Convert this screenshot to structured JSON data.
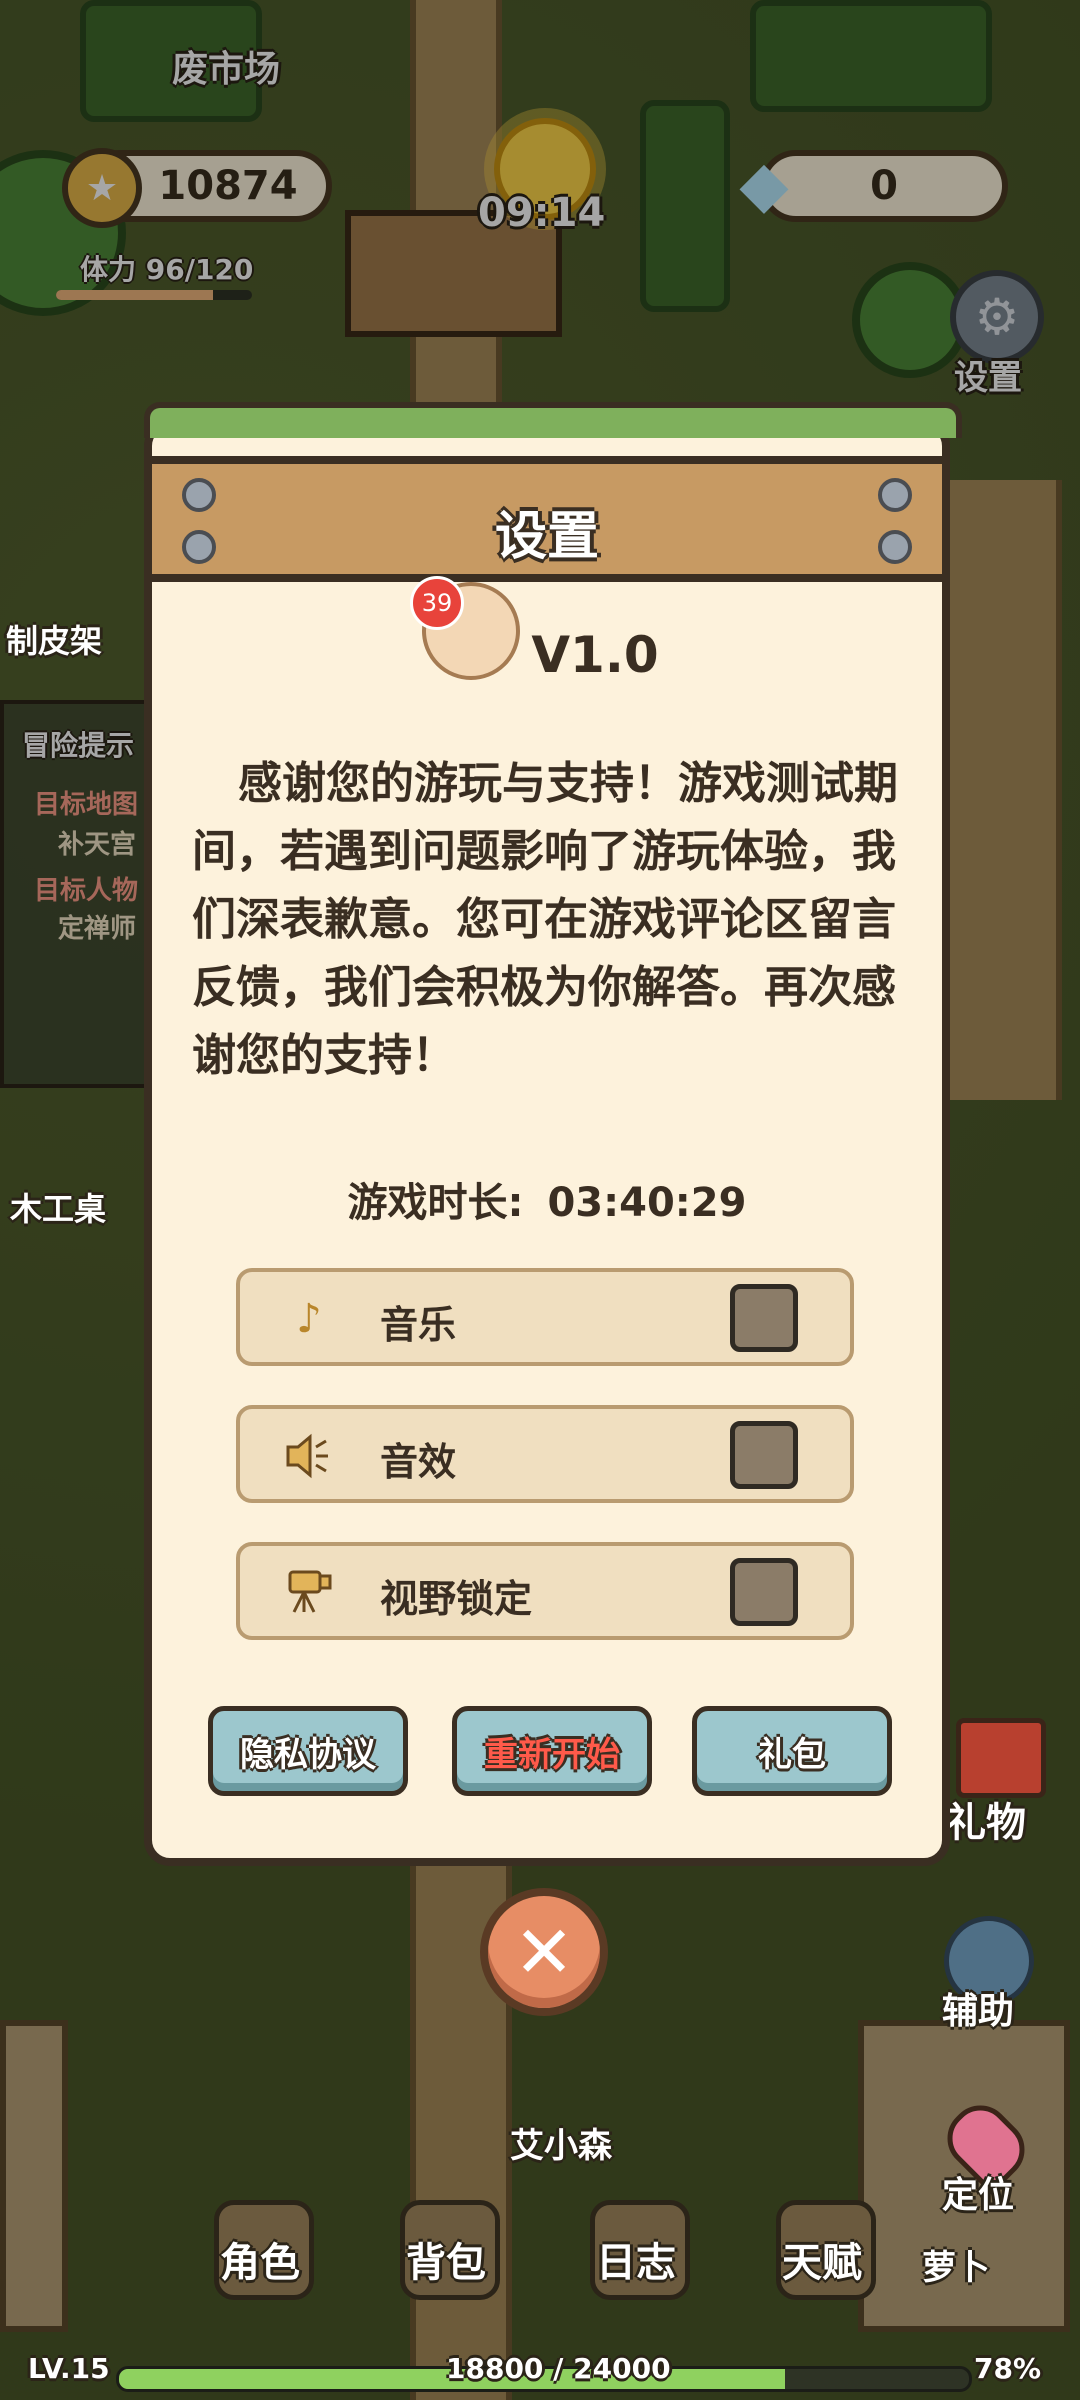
{
  "hud": {
    "coins": "10874",
    "time": "09:14",
    "gems": "0",
    "stamina": "体力 96/120",
    "stamina_progress": 0.8
  },
  "map_labels": {
    "waste_market": "废市场",
    "tannery": "制皮架",
    "workbench": "木工桌",
    "npc_name": "艾小森",
    "carrot": "萝卜"
  },
  "quest_panel": {
    "title": "冒险提示",
    "target_map_label": "目标地图",
    "target_map_value": "补天宫",
    "target_char_label": "目标人物",
    "target_char_value": "定禅师"
  },
  "side_buttons": {
    "settings": "设置",
    "gift": "礼物",
    "assist": "辅助",
    "locate": "定位"
  },
  "dialog": {
    "title": "设置",
    "version": "V1.0",
    "badge_count": "39",
    "thanks_text": "感谢您的游玩与支持！游戏测试期间，若遇到问题影响了游玩体验，我们深表歉意。您可在游戏评论区留言反馈，我们会积极为你解答。再次感谢您的支持！",
    "playtime_label": "游戏时长:",
    "playtime_value": "03:40:29",
    "options": [
      {
        "label": "音乐",
        "icon": "music-note-icon",
        "checked": false
      },
      {
        "label": "音效",
        "icon": "speaker-icon",
        "checked": false
      },
      {
        "label": "视野锁定",
        "icon": "camera-icon",
        "checked": false
      }
    ],
    "buttons": {
      "privacy": "隐私协议",
      "restart": "重新开始",
      "gift_pack": "礼包"
    }
  },
  "bottom_nav": {
    "character": "角色",
    "bag": "背包",
    "journal": "日志",
    "talent": "天赋"
  },
  "footer": {
    "level": "LV.15",
    "xp": "18800 / 24000",
    "xp_progress": 0.7833,
    "percent": "78%"
  }
}
